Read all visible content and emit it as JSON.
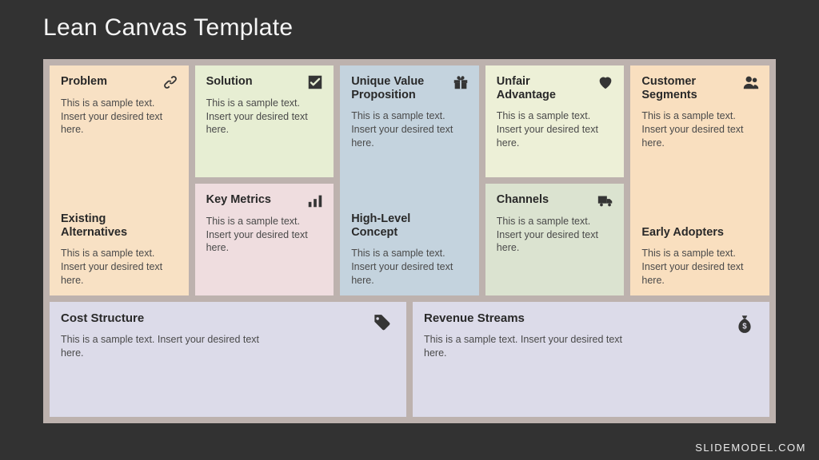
{
  "title": "Lean Canvas Template",
  "sample": "This is a sample text. Insert your desired text here.",
  "cells": {
    "problem": {
      "label": "Problem",
      "icon": "link",
      "color": "peach"
    },
    "alternatives": {
      "label": "Existing Alternatives",
      "color": "peach"
    },
    "solution": {
      "label": "Solution",
      "icon": "check",
      "color": "mint"
    },
    "metrics": {
      "label": "Key Metrics",
      "icon": "bars",
      "color": "pink"
    },
    "uvp": {
      "label": "Unique Value Proposition",
      "icon": "gift",
      "color": "blue"
    },
    "hlc": {
      "label": "High-Level Concept",
      "color": "blue"
    },
    "advantage": {
      "label": "Unfair Advantage",
      "icon": "heart",
      "color": "green"
    },
    "channels": {
      "label": "Channels",
      "icon": "truck",
      "color": "sage"
    },
    "segments": {
      "label": "Customer Segments",
      "icon": "users",
      "color": "peach2"
    },
    "adopters": {
      "label": "Early Adopters",
      "color": "peach2"
    },
    "cost": {
      "label": "Cost Structure",
      "icon": "tag",
      "color": "lav"
    },
    "revenue": {
      "label": "Revenue Streams",
      "icon": "moneybag",
      "color": "lav"
    }
  },
  "footer": "SLIDEMODEL.COM"
}
